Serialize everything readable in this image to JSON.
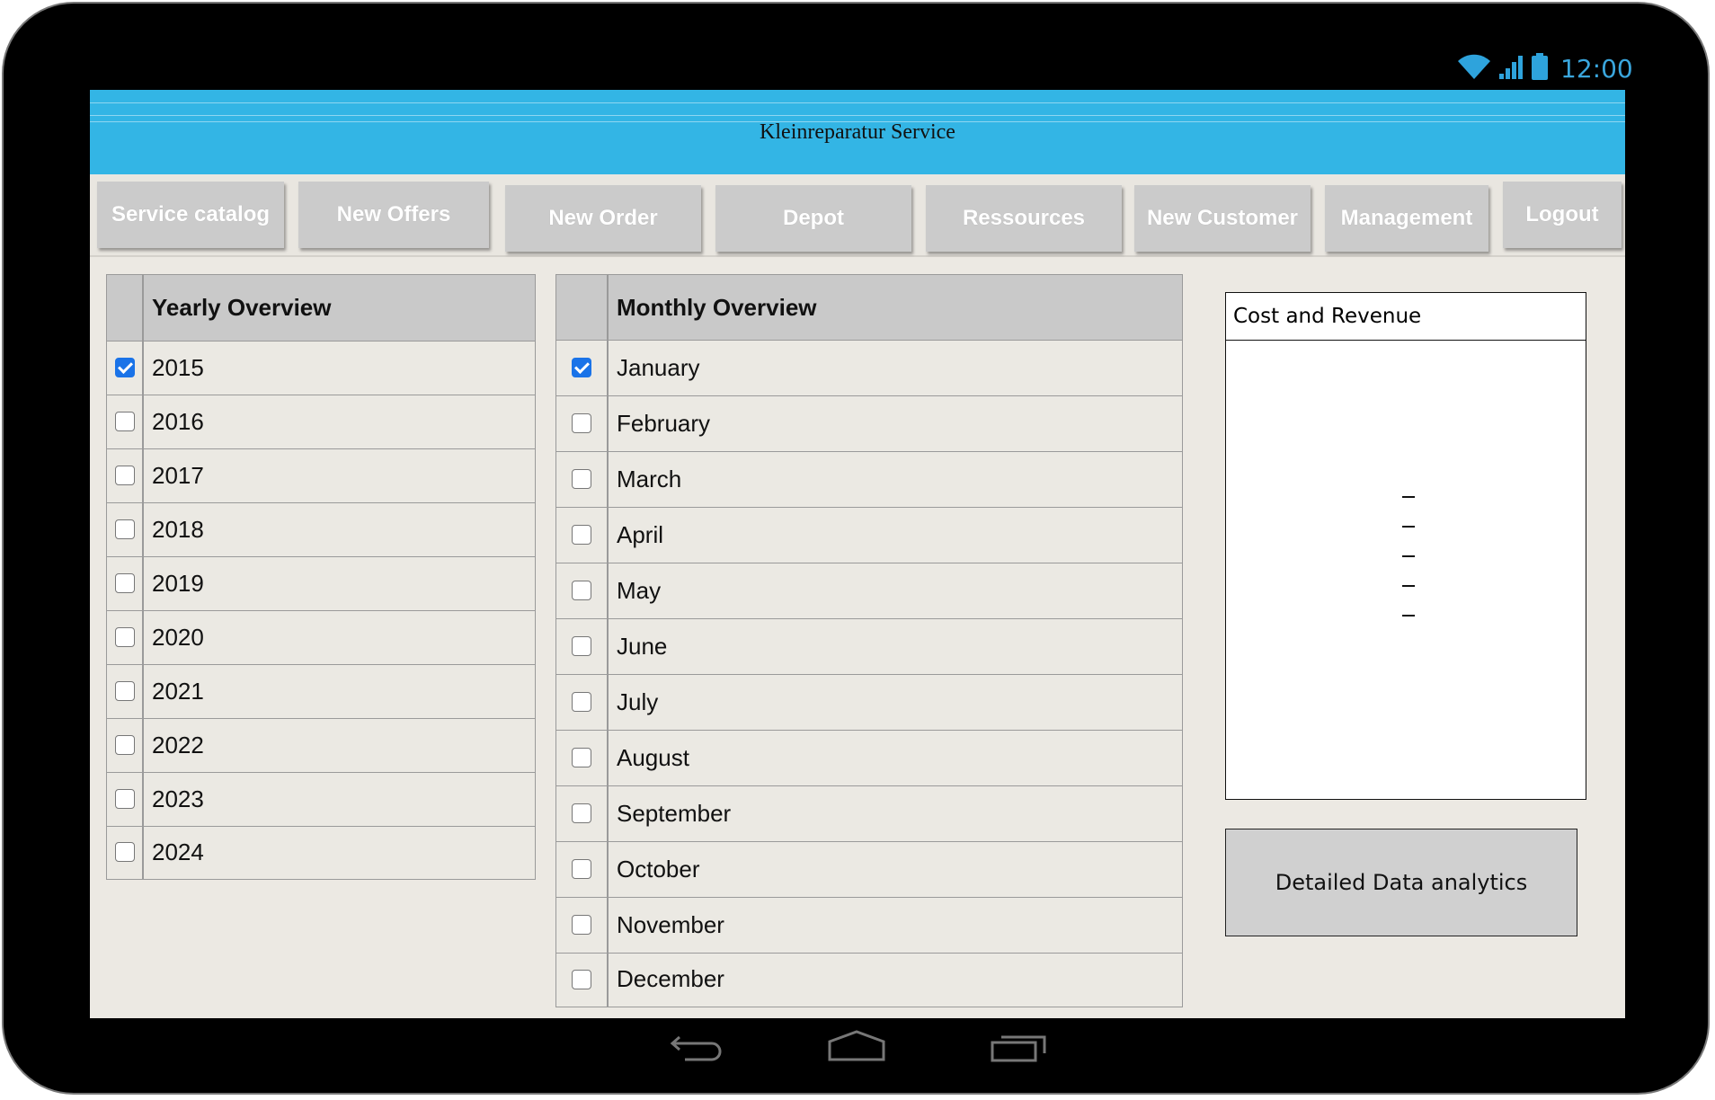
{
  "status_bar": {
    "time": "12:00",
    "icons": [
      "wifi-icon",
      "signal-icon",
      "battery-icon"
    ]
  },
  "app": {
    "title": "Kleinreparatur Service",
    "accent_color": "#33b5e5"
  },
  "tabs": [
    {
      "label": "Service catalog"
    },
    {
      "label": "New Offers"
    },
    {
      "label": "New Order"
    },
    {
      "label": "Depot"
    },
    {
      "label": "Ressources"
    },
    {
      "label": "New Customer"
    },
    {
      "label": "Management"
    },
    {
      "label": "Logout"
    }
  ],
  "yearly": {
    "header": "Yearly Overview",
    "rows": [
      {
        "label": "2015",
        "checked": true
      },
      {
        "label": "2016",
        "checked": false
      },
      {
        "label": "2017",
        "checked": false
      },
      {
        "label": "2018",
        "checked": false
      },
      {
        "label": "2019",
        "checked": false
      },
      {
        "label": "2020",
        "checked": false
      },
      {
        "label": "2021",
        "checked": false
      },
      {
        "label": "2022",
        "checked": false
      },
      {
        "label": "2023",
        "checked": false
      },
      {
        "label": "2024",
        "checked": false
      }
    ]
  },
  "monthly": {
    "header": "Monthly Overview",
    "rows": [
      {
        "label": "January",
        "checked": true
      },
      {
        "label": "February",
        "checked": false
      },
      {
        "label": "March",
        "checked": false
      },
      {
        "label": "April",
        "checked": false
      },
      {
        "label": "May",
        "checked": false
      },
      {
        "label": "June",
        "checked": false
      },
      {
        "label": "July",
        "checked": false
      },
      {
        "label": "August",
        "checked": false
      },
      {
        "label": "September",
        "checked": false
      },
      {
        "label": "October",
        "checked": false
      },
      {
        "label": "November",
        "checked": false
      },
      {
        "label": "December",
        "checked": false
      }
    ]
  },
  "cost_panel": {
    "title": "Cost and Revenue"
  },
  "analytics_button": {
    "label": "Detailed Data analytics"
  },
  "nav_bar": {
    "icons": [
      "back-icon",
      "home-icon",
      "recent-apps-icon"
    ]
  }
}
